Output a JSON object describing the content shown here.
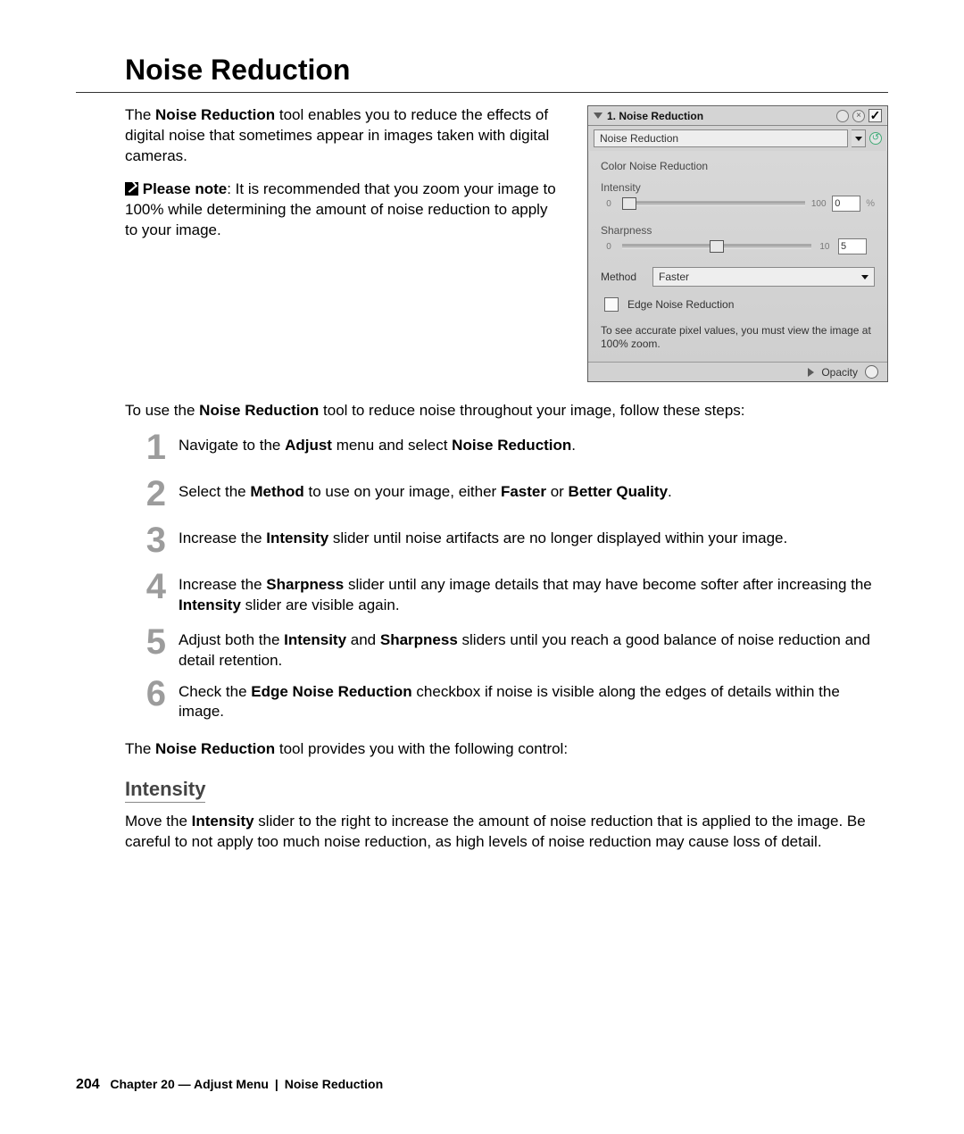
{
  "title": "Noise Reduction",
  "intro": {
    "p1_pre": "The ",
    "p1_bold": "Noise Reduction",
    "p1_post": " tool enables you to reduce the effects of digital noise that sometimes appear in images taken with digital cameras.",
    "note_label": "Please note",
    "note_text": ": It is recommended that you zoom your image to 100% while determining the amount of noise reduction to apply to your image."
  },
  "panel": {
    "header_title": "1. Noise Reduction",
    "circle1_glyph": "",
    "circle2_glyph": "×",
    "check_glyph": "✓",
    "preset_label": "Noise Reduction",
    "reset_glyph": "↺",
    "section_label": "Color Noise Reduction",
    "intensity_label": "Intensity",
    "intensity_min": "0",
    "intensity_max": "100",
    "intensity_value": "0",
    "intensity_unit": "%",
    "intensity_knob_left": "4%",
    "sharpness_label": "Sharpness",
    "sharpness_min": "0",
    "sharpness_max": "10",
    "sharpness_value": "5",
    "sharpness_knob_left": "50%",
    "method_label": "Method",
    "method_value": "Faster",
    "edge_label": "Edge Noise Reduction",
    "hint_text": "To see accurate pixel values, you must view the image at 100% zoom.",
    "opacity_label": "Opacity"
  },
  "lead_pre": "To use the ",
  "lead_bold": "Noise Reduction",
  "lead_post": " tool to reduce noise throughout your image, follow these steps:",
  "steps": {
    "s1_num": "1",
    "s1_a": "Navigate to the ",
    "s1_b1": "Adjust",
    "s1_b": " menu and select ",
    "s1_b2": "Noise Reduction",
    "s1_c": ".",
    "s2_num": "2",
    "s2_a": "Select the ",
    "s2_b1": "Method",
    "s2_b": " to use on your image, either ",
    "s2_b2": "Faster",
    "s2_c": " or ",
    "s2_b3": "Better Quality",
    "s2_d": ".",
    "s3_num": "3",
    "s3_a": "Increase the ",
    "s3_b1": "Intensity",
    "s3_b": " slider until noise artifacts are no longer displayed within your image.",
    "s4_num": "4",
    "s4_a": "Increase the ",
    "s4_b1": "Sharpness",
    "s4_b": " slider until any image details that may have become softer after increasing the ",
    "s4_b2": "Intensity",
    "s4_c": " slider are visible again.",
    "s5_num": "5",
    "s5_a": "Adjust both the ",
    "s5_b1": "Intensity",
    "s5_b": " and ",
    "s5_b2": "Sharpness",
    "s5_c": " sliders until you reach a good balance of noise reduction and detail retention.",
    "s6_num": "6",
    "s6_a": "Check the ",
    "s6_b1": "Edge Noise Reduction",
    "s6_b": " checkbox if noise is visible along the edges of details within the image."
  },
  "controls_lead_pre": "The ",
  "controls_lead_bold": "Noise Reduction",
  "controls_lead_post": " tool provides you with the following control:",
  "sub_heading": "Intensity",
  "sub_desc_pre": "Move the ",
  "sub_desc_bold": "Intensity",
  "sub_desc_post": " slider to the right to increase the amount of noise reduction that is applied to the image. Be careful to not apply too much noise reduction, as high levels of noise reduction may cause loss of detail.",
  "footer": {
    "page_num": "204",
    "chapter": "Chapter 20 — Adjust Menu",
    "section": "Noise Reduction"
  }
}
